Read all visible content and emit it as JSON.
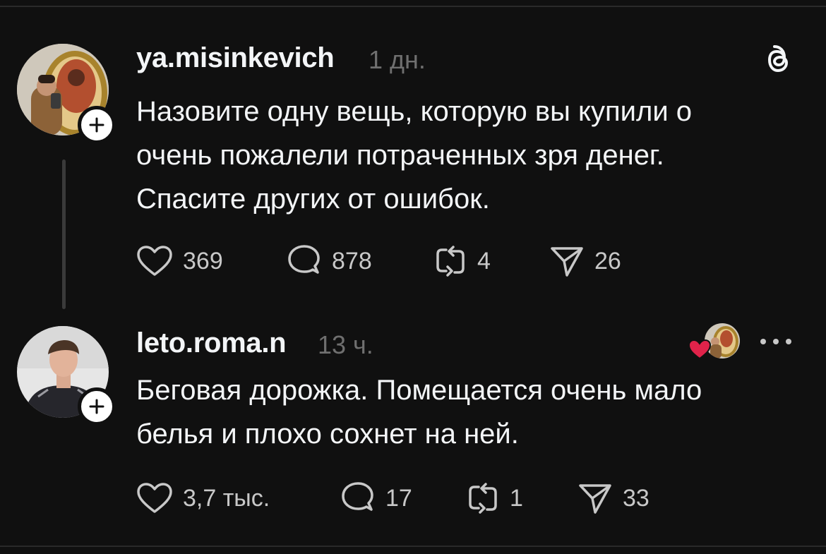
{
  "posts": [
    {
      "username": "ya.misinkevich",
      "time": "1 дн.",
      "text_lines": [
        "Назовите одну вещь, которую вы купили о",
        "очень пожалели потраченных зря денег.",
        "Спасите других от ошибок."
      ],
      "likes": "369",
      "replies": "878",
      "reposts": "4",
      "shares": "26"
    },
    {
      "username": "leto.roma.n",
      "time": "13 ч.",
      "text_lines": [
        "Беговая дорожка. Помещается очень мало",
        "белья и плохо сохнет на ней."
      ],
      "likes": "3,7 тыс.",
      "replies": "17",
      "reposts": "1",
      "shares": "33"
    }
  ],
  "icons": {
    "threads_logo": "threads-logo-icon",
    "like": "heart-icon",
    "reply": "comment-icon",
    "repost": "repost-icon",
    "share": "send-icon",
    "more": "more-icon",
    "follow": "plus-icon"
  },
  "colors": {
    "background": "#101010",
    "text": "#f3f5f7",
    "muted": "#6f6f6f",
    "liked_heart": "#e0234a"
  }
}
